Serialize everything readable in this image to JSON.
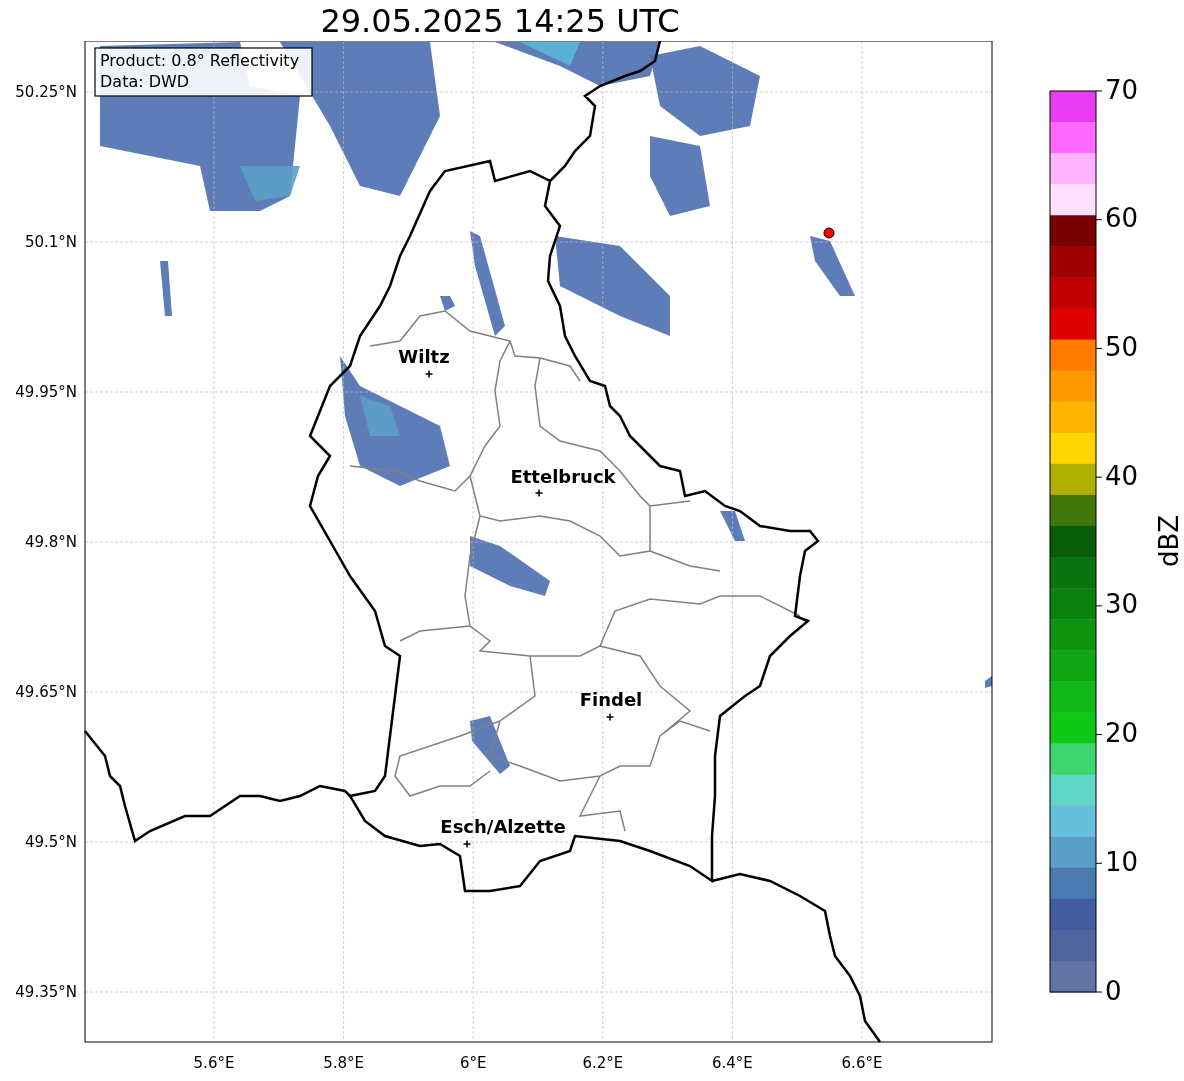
{
  "title": "29.05.2025 14:25 UTC",
  "info_box": [
    "Product: 0.8° Reflectivity",
    "Data: DWD"
  ],
  "map": {
    "x_tick_labels": [
      "5.6°E",
      "5.8°E",
      "6°E",
      "6.2°E",
      "6.4°E",
      "6.6°E"
    ],
    "y_tick_labels": [
      "50.25°N",
      "50.1°N",
      "49.95°N",
      "49.8°N",
      "49.65°N",
      "49.5°N",
      "49.35°N"
    ],
    "cities": [
      {
        "name": "Wiltz"
      },
      {
        "name": "Ettelbruck"
      },
      {
        "name": "Findel"
      },
      {
        "name": "Esch/Alzette"
      }
    ]
  },
  "colorbar": {
    "label": "dBZ",
    "ticks": [
      "70",
      "60",
      "50",
      "40",
      "30",
      "20",
      "10",
      "0"
    ],
    "segments": [
      {
        "color": "#e83cf0"
      },
      {
        "color": "#ff6aff"
      },
      {
        "color": "#ffb4ff"
      },
      {
        "color": "#ffe0ff"
      },
      {
        "color": "#780000"
      },
      {
        "color": "#a00000"
      },
      {
        "color": "#c00000"
      },
      {
        "color": "#e00000"
      },
      {
        "color": "#ff7d00"
      },
      {
        "color": "#ff9b00"
      },
      {
        "color": "#ffb400"
      },
      {
        "color": "#ffd700"
      },
      {
        "color": "#b0b000"
      },
      {
        "color": "#42760a"
      },
      {
        "color": "#085c0a"
      },
      {
        "color": "#0a720e"
      },
      {
        "color": "#0b8210"
      },
      {
        "color": "#0f9412"
      },
      {
        "color": "#10a514"
      },
      {
        "color": "#12b818"
      },
      {
        "color": "#10c818"
      },
      {
        "color": "#3ed56e"
      },
      {
        "color": "#62d6c4"
      },
      {
        "color": "#66c0dc"
      },
      {
        "color": "#5b9fc8"
      },
      {
        "color": "#4a7ab0"
      },
      {
        "color": "#425c9f"
      },
      {
        "color": "#50659e"
      },
      {
        "color": "#6274a6"
      }
    ]
  }
}
